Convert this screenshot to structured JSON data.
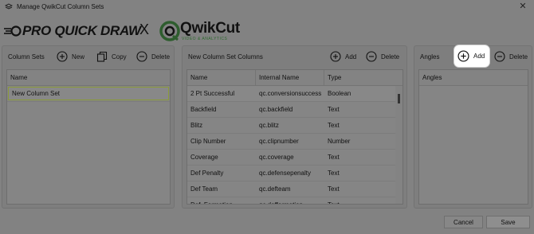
{
  "window": {
    "title": "Manage QwikCut Column Sets"
  },
  "logos": {
    "pqd_text": "PRO QUICK DRAW",
    "separator": "X",
    "qc_text": "QwikCut",
    "qc_subtext": "VIDEO & ANALYTICS"
  },
  "column_sets": {
    "title": "Column Sets",
    "new_label": "New",
    "copy_label": "Copy",
    "delete_label": "Delete",
    "header": "Name",
    "rows": [
      "New Column Set"
    ]
  },
  "columns": {
    "title": "New Column Set Columns",
    "add_label": "Add",
    "delete_label": "Delete",
    "headers": [
      "Name",
      "Internal Name",
      "Type"
    ],
    "rows": [
      [
        "2 Pt Successful",
        "qc.conversionsuccess",
        "Boolean"
      ],
      [
        "Backfield",
        "qc.backfield",
        "Text"
      ],
      [
        "Blitz",
        "qc.blitz",
        "Text"
      ],
      [
        "Clip Number",
        "qc.clipnumber",
        "Number"
      ],
      [
        "Coverage",
        "qc.coverage",
        "Text"
      ],
      [
        "Def Penalty",
        "qc.defensepenalty",
        "Text"
      ],
      [
        "Def Team",
        "qc.defteam",
        "Text"
      ],
      [
        "Def. Formation",
        "qc.defformation",
        "Text"
      ]
    ]
  },
  "angles": {
    "title": "Angles",
    "add_label": "Add",
    "delete_label": "Delete",
    "header": "Angles"
  },
  "footer": {
    "cancel_label": "Cancel",
    "save_label": "Save"
  },
  "icons": {
    "app": "app-icon",
    "close": "close-icon",
    "add": "plus-circle-icon",
    "delete": "minus-circle-icon",
    "copy": "copy-icon"
  }
}
